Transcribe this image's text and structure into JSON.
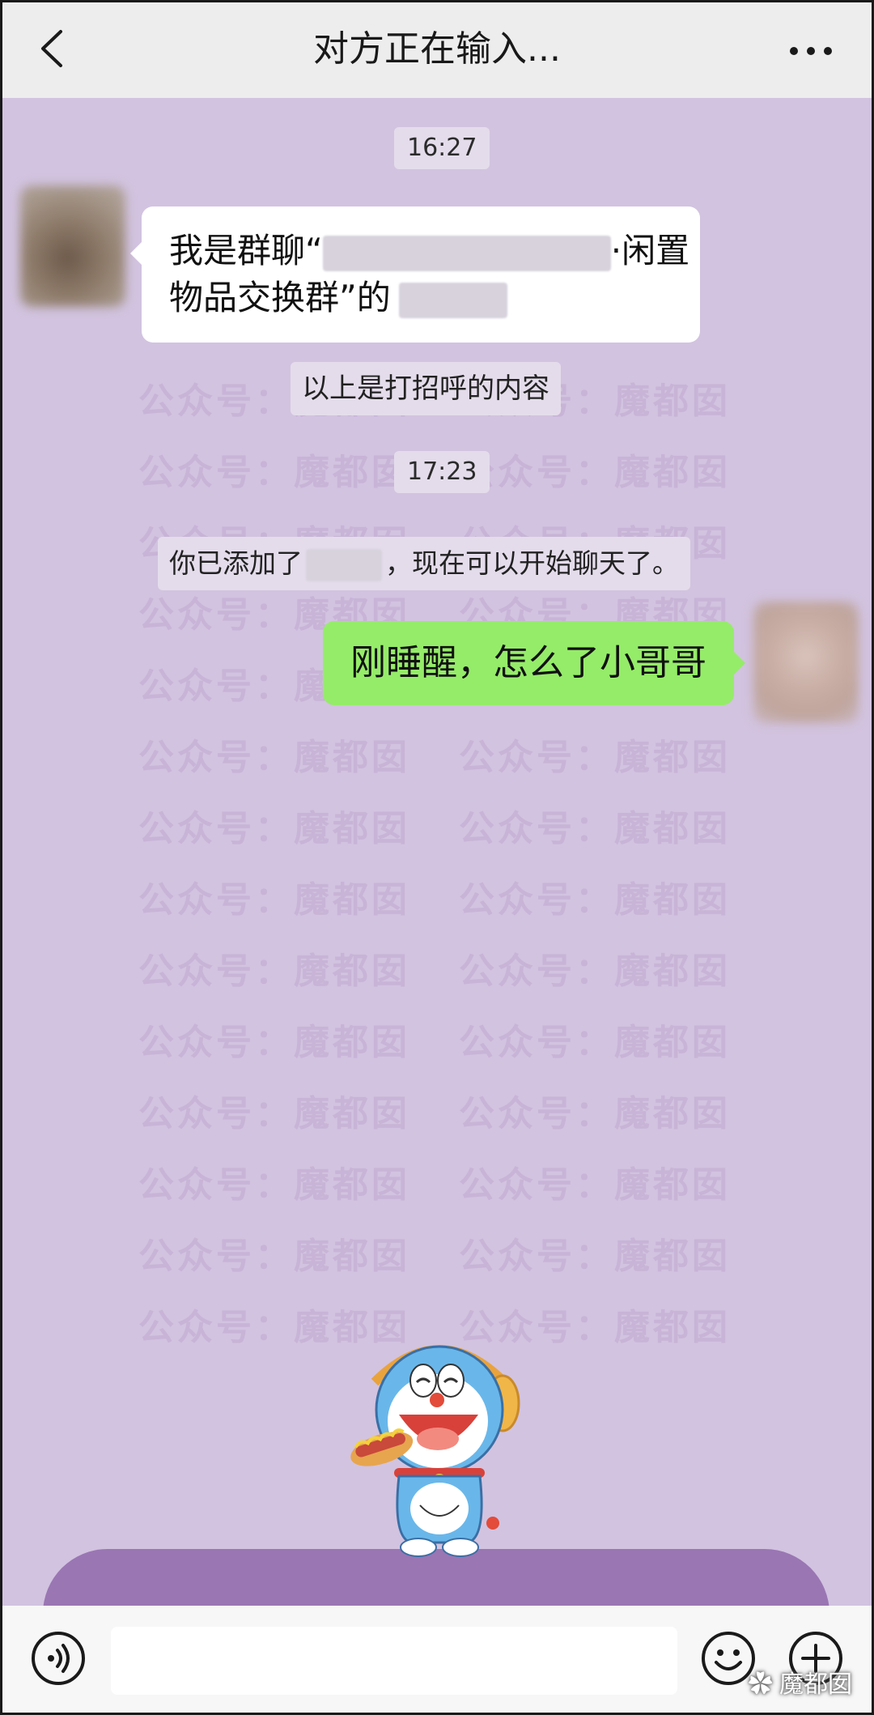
{
  "header": {
    "title": "对方正在输入...",
    "back_icon": "chevron-left-icon",
    "more_icon": "more-dots-icon"
  },
  "chat": {
    "time1": "16:27",
    "incoming_message": {
      "line1_prefix": "我是群聊“",
      "line1_suffix": "·闲置",
      "line2_prefix": "物品交换群”的"
    },
    "system_greeting": "以上是打招呼的内容",
    "time2": "17:23",
    "system_added": {
      "prefix": "你已添加了",
      "suffix": "，现在可以开始聊天了。"
    },
    "outgoing_message": "刚睡醒，怎么了小哥哥",
    "watermark_text": "公众号：魔都囡"
  },
  "inputbar": {
    "voice_icon": "voice-icon",
    "emoji_icon": "emoji-icon",
    "plus_icon": "plus-icon",
    "input_value": ""
  },
  "footer": {
    "mark_text": "魔都囡"
  },
  "colors": {
    "chat_background": "#d2c3e0",
    "outgoing_bubble": "#95ec69",
    "incoming_bubble": "#ffffff",
    "header_background": "#ededed"
  }
}
